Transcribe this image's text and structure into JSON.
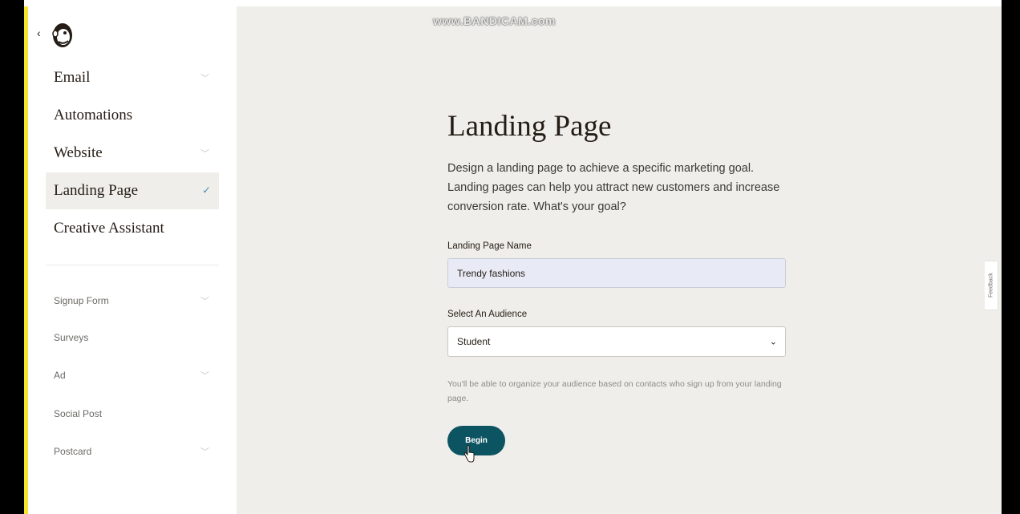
{
  "watermark": "www.BANDICAM.com",
  "sidebar": {
    "collapse_icon": "chevron-left-icon",
    "logo_icon": "mailchimp-freddie-icon",
    "primary_items": [
      {
        "label": "Email",
        "has_chevron": true
      },
      {
        "label": "Automations",
        "has_chevron": false
      },
      {
        "label": "Website",
        "has_chevron": true
      },
      {
        "label": "Landing Page",
        "active": true,
        "check": "✓"
      },
      {
        "label": "Creative Assistant",
        "has_chevron": false
      }
    ],
    "secondary_items": [
      {
        "label": "Signup Form",
        "has_chevron": true
      },
      {
        "label": "Surveys",
        "has_chevron": false
      },
      {
        "label": "Ad",
        "has_chevron": true
      },
      {
        "label": "Social Post",
        "has_chevron": false
      },
      {
        "label": "Postcard",
        "has_chevron": true
      }
    ],
    "chevron_glyph": "﹀"
  },
  "main": {
    "title": "Landing Page",
    "description": "Design a landing page to achieve a specific marketing goal. Landing pages can help you attract new customers and increase conversion rate. What's your goal?",
    "name_label": "Landing Page Name",
    "name_value": "Trendy fashions",
    "audience_label": "Select An Audience",
    "audience_value": "Student",
    "help_text": "You'll be able to organize your audience based on contacts who sign up from your landing page.",
    "begin_label": "Begin"
  },
  "feedback_label": "Feedback",
  "colors": {
    "accent_button": "#0d5462",
    "main_bg": "#efeeea",
    "input_bg": "#e8ebf6",
    "yellow_strip": "#f5e330"
  }
}
